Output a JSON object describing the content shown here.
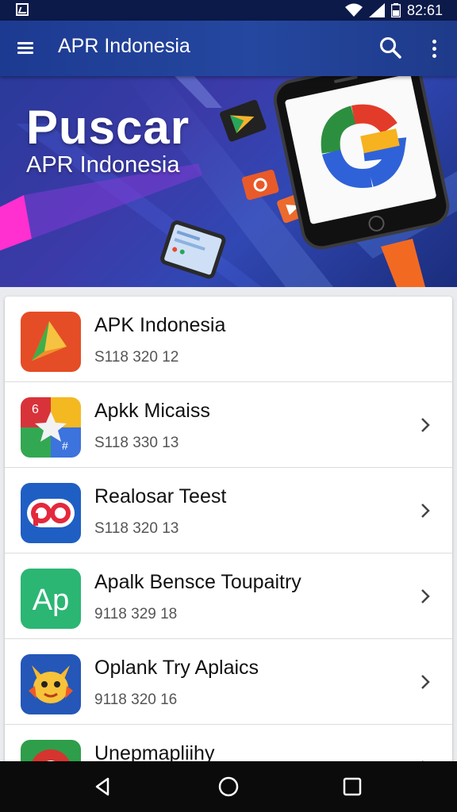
{
  "status_bar": {
    "time": "82:61"
  },
  "app_bar": {
    "title": "APR Indonesia",
    "icons": [
      "menu-icon",
      "search-icon",
      "more-vert-icon"
    ]
  },
  "hero": {
    "title": "Puscar",
    "subtitle": "APR Indonesia"
  },
  "apps": [
    {
      "name": "APK Indonesia",
      "meta": "S118 320 12",
      "icon": "play-triangle-icon",
      "chevron": false
    },
    {
      "name": "Apkk Micaiss",
      "meta": "S118 330 13",
      "icon": "star-puzzle-icon",
      "chevron": true
    },
    {
      "name": "Realosar Teest",
      "meta": "S118 320 13",
      "icon": "po-logo-icon",
      "chevron": true
    },
    {
      "name": "Apalk Bensce Toupaitry",
      "meta": "9118 329 18",
      "icon": "ap-logo-icon",
      "chevron": true
    },
    {
      "name": "Oplank Try Aplaics",
      "meta": "9118 320 16",
      "icon": "cartoon-mascot-icon",
      "chevron": true
    },
    {
      "name": "Unepmapliihy",
      "meta": "",
      "icon": "chrome-like-icon",
      "chevron": true
    }
  ],
  "colors": {
    "app_bar": "#1d3a91",
    "hero_bg": "#2f3ea8",
    "nav_bar": "#0b0b0b",
    "ap_green": "#2bb673"
  }
}
